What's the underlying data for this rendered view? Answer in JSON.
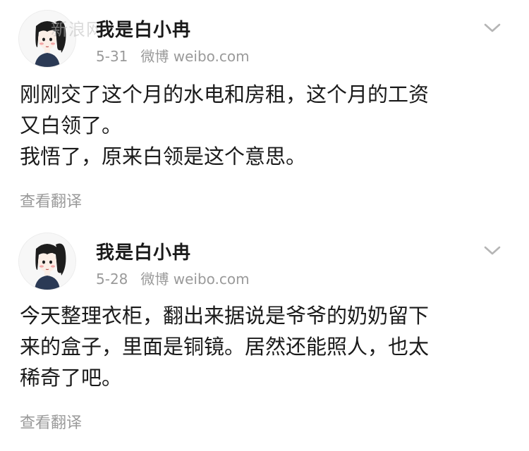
{
  "watermark": "新浪网",
  "posts": [
    {
      "username": "我是白小冉",
      "date": "5-31",
      "source": "微博 weibo.com",
      "content_lines": [
        "刚刚交了这个月的水电和房租，这个月的工资",
        "又白领了。",
        "我悟了，原来白领是这个意思。"
      ],
      "translate_label": "查看翻译"
    },
    {
      "username": "我是白小冉",
      "date": "5-28",
      "source": "微博 weibo.com",
      "content_lines": [
        "今天整理衣柜，翻出来据说是爷爷的奶奶留下",
        "来的盒子，里面是铜镜。居然还能照人，也太",
        "稀奇了吧。"
      ],
      "translate_label": "查看翻译"
    }
  ],
  "icons": {
    "avatar": "avatar-girl-illustration",
    "menu": "chevron-down-icon"
  },
  "colors": {
    "text_primary": "#1a1a1a",
    "text_secondary": "#9a9a9a",
    "background": "#ffffff"
  }
}
